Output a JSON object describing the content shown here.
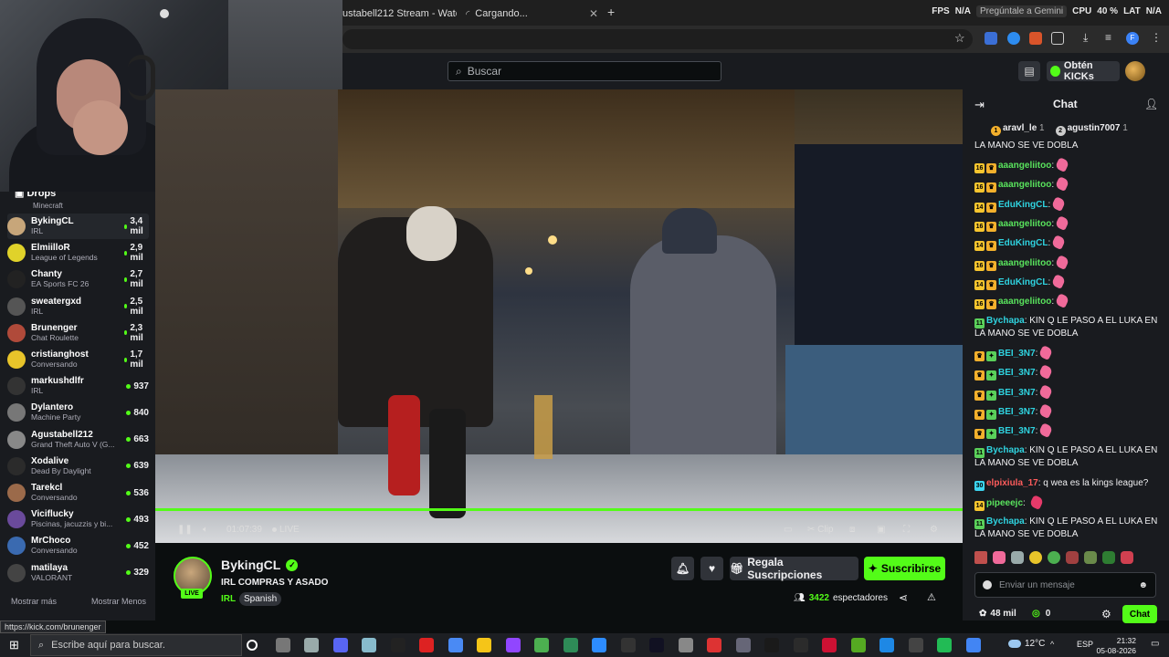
{
  "browser": {
    "tabs": [
      {
        "title": "ustabell212 Stream - Watch"
      },
      {
        "title": "Cargando..."
      }
    ],
    "stats": {
      "fps_label": "FPS",
      "fps_value": "N/A",
      "gpu_label": "",
      "cpu_label": "CPU",
      "cpu_value": "40 %",
      "lat_label": "LAT",
      "lat_value": "N/A",
      "overlay": "Pregúntale a Gemini"
    }
  },
  "kick": {
    "search_placeholder": "Buscar",
    "get_kicks": "Obtén KICKs"
  },
  "sidebar": {
    "drops_label": "Drops",
    "hidden_category": "Minecraft",
    "channels": [
      {
        "name": "BykingCL",
        "category": "IRL",
        "viewers": "3,4 mil",
        "color": "#c7a67a"
      },
      {
        "name": "ElmiilloR",
        "category": "League of Legends",
        "viewers": "2,9 mil",
        "color": "#e0d22a"
      },
      {
        "name": "Chanty",
        "category": "EA Sports FC 26",
        "viewers": "2,7 mil",
        "color": "#222"
      },
      {
        "name": "sweatergxd",
        "category": "IRL",
        "viewers": "2,5 mil",
        "color": "#555"
      },
      {
        "name": "Brunenger",
        "category": "Chat Roulette",
        "viewers": "2,3 mil",
        "color": "#b04a3a"
      },
      {
        "name": "cristianghost",
        "category": "Conversando",
        "viewers": "1,7 mil",
        "color": "#e8c42a"
      },
      {
        "name": "markushdlfr",
        "category": "IRL",
        "viewers": "937",
        "color": "#333"
      },
      {
        "name": "Dylantero",
        "category": "Machine Party",
        "viewers": "840",
        "color": "#777"
      },
      {
        "name": "Agustabell212",
        "category": "Grand Theft Auto V (G...",
        "viewers": "663",
        "color": "#888"
      },
      {
        "name": "Xodalive",
        "category": "Dead By Daylight",
        "viewers": "639",
        "color": "#2b2b2b"
      },
      {
        "name": "Tarekcl",
        "category": "Conversando",
        "viewers": "536",
        "color": "#9b6a4a"
      },
      {
        "name": "Viciflucky",
        "category": "Piscinas, jacuzzis y bi...",
        "viewers": "493",
        "color": "#6a4a9b"
      },
      {
        "name": "MrChoco",
        "category": "Conversando",
        "viewers": "452",
        "color": "#3a6ab0"
      },
      {
        "name": "matilaya",
        "category": "VALORANT",
        "viewers": "329",
        "color": "#444"
      }
    ],
    "show_more": "Mostrar más",
    "show_less": "Mostrar Menos"
  },
  "player": {
    "time": "01:07:39",
    "live": "LIVE",
    "clip": "Clip",
    "progress": 1.0
  },
  "stream": {
    "name": "BykingCL",
    "title": "IRL COMPRAS Y ASADO",
    "category": "IRL",
    "language": "Spanish",
    "live_badge": "LIVE",
    "gift_label": "Regala Suscripciones",
    "subscribe_label": "Suscribirse",
    "viewers": "3422",
    "viewers_label": "espectadores"
  },
  "chat": {
    "title": "Chat",
    "pinned": [
      {
        "name": "aravl_le",
        "count": "1"
      },
      {
        "name": "agustin7007",
        "count": "1"
      }
    ],
    "first_line": "LA MANO SE VE DOBLA",
    "messages": [
      {
        "badge": "16",
        "name": "aaangeliitoo",
        "color": "#59e35d",
        "text": "",
        "emote": true
      },
      {
        "badge": "16",
        "name": "aaangeliitoo",
        "color": "#59e35d",
        "text": "",
        "emote": true
      },
      {
        "badge": "14",
        "name": "EduKingCL",
        "color": "#2fd3e0",
        "text": "",
        "emote": true
      },
      {
        "badge": "16",
        "name": "aaangeliitoo",
        "color": "#59e35d",
        "text": "",
        "emote": true
      },
      {
        "badge": "14",
        "name": "EduKingCL",
        "color": "#2fd3e0",
        "text": "",
        "emote": true
      },
      {
        "badge": "16",
        "name": "aaangeliitoo",
        "color": "#59e35d",
        "text": "",
        "emote": true
      },
      {
        "badge": "14",
        "name": "EduKingCL",
        "color": "#2fd3e0",
        "text": "",
        "emote": true
      },
      {
        "badge": "16",
        "name": "aaangeliitoo",
        "color": "#59e35d",
        "text": "",
        "emote": true
      }
    ],
    "bychapa1": {
      "badge": "11",
      "name": "Bychapa",
      "text": "KIN Q LE PASO A EL LUKA EN",
      "text2": "LA MANO SE VE DOBLA"
    },
    "bei": {
      "name": "BEI_3N7",
      "count": 5
    },
    "bychapa2": {
      "badge": "11",
      "name": "Bychapa",
      "text": "KIN Q LE PASO A EL LUKA EN",
      "text2": "LA MANO SE VE DOBLA"
    },
    "elpixiula": {
      "badge": "30",
      "name": "elpixiula_17",
      "text": "q wea es la kings league?"
    },
    "pipeeejc": {
      "badge": "14",
      "name": "pipeeejc"
    },
    "bychapa3": {
      "badge": "11",
      "name": "Bychapa",
      "text": "KIN Q LE PASO A EL LUKA EN",
      "text2": "LA MANO SE VE DOBLA"
    },
    "input_placeholder": "Enviar un mensaje",
    "kicks_count": "48 mil",
    "zero_count": "0",
    "send_label": "Chat"
  },
  "status_url": "https://kick.com/brunenger",
  "taskbar": {
    "search_placeholder": "Escribe aquí para buscar.",
    "weather": "12°C",
    "lang": "ESP",
    "time": "21:32",
    "date": "05-08-2026"
  }
}
